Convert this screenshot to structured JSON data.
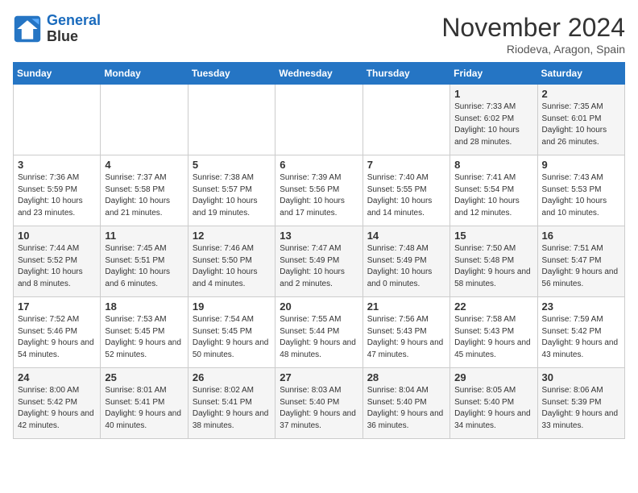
{
  "header": {
    "logo_line1": "General",
    "logo_line2": "Blue",
    "month": "November 2024",
    "location": "Riodeva, Aragon, Spain"
  },
  "weekdays": [
    "Sunday",
    "Monday",
    "Tuesday",
    "Wednesday",
    "Thursday",
    "Friday",
    "Saturday"
  ],
  "weeks": [
    [
      {
        "day": "",
        "info": ""
      },
      {
        "day": "",
        "info": ""
      },
      {
        "day": "",
        "info": ""
      },
      {
        "day": "",
        "info": ""
      },
      {
        "day": "",
        "info": ""
      },
      {
        "day": "1",
        "info": "Sunrise: 7:33 AM\nSunset: 6:02 PM\nDaylight: 10 hours\nand 28 minutes."
      },
      {
        "day": "2",
        "info": "Sunrise: 7:35 AM\nSunset: 6:01 PM\nDaylight: 10 hours\nand 26 minutes."
      }
    ],
    [
      {
        "day": "3",
        "info": "Sunrise: 7:36 AM\nSunset: 5:59 PM\nDaylight: 10 hours\nand 23 minutes."
      },
      {
        "day": "4",
        "info": "Sunrise: 7:37 AM\nSunset: 5:58 PM\nDaylight: 10 hours\nand 21 minutes."
      },
      {
        "day": "5",
        "info": "Sunrise: 7:38 AM\nSunset: 5:57 PM\nDaylight: 10 hours\nand 19 minutes."
      },
      {
        "day": "6",
        "info": "Sunrise: 7:39 AM\nSunset: 5:56 PM\nDaylight: 10 hours\nand 17 minutes."
      },
      {
        "day": "7",
        "info": "Sunrise: 7:40 AM\nSunset: 5:55 PM\nDaylight: 10 hours\nand 14 minutes."
      },
      {
        "day": "8",
        "info": "Sunrise: 7:41 AM\nSunset: 5:54 PM\nDaylight: 10 hours\nand 12 minutes."
      },
      {
        "day": "9",
        "info": "Sunrise: 7:43 AM\nSunset: 5:53 PM\nDaylight: 10 hours\nand 10 minutes."
      }
    ],
    [
      {
        "day": "10",
        "info": "Sunrise: 7:44 AM\nSunset: 5:52 PM\nDaylight: 10 hours\nand 8 minutes."
      },
      {
        "day": "11",
        "info": "Sunrise: 7:45 AM\nSunset: 5:51 PM\nDaylight: 10 hours\nand 6 minutes."
      },
      {
        "day": "12",
        "info": "Sunrise: 7:46 AM\nSunset: 5:50 PM\nDaylight: 10 hours\nand 4 minutes."
      },
      {
        "day": "13",
        "info": "Sunrise: 7:47 AM\nSunset: 5:49 PM\nDaylight: 10 hours\nand 2 minutes."
      },
      {
        "day": "14",
        "info": "Sunrise: 7:48 AM\nSunset: 5:49 PM\nDaylight: 10 hours\nand 0 minutes."
      },
      {
        "day": "15",
        "info": "Sunrise: 7:50 AM\nSunset: 5:48 PM\nDaylight: 9 hours\nand 58 minutes."
      },
      {
        "day": "16",
        "info": "Sunrise: 7:51 AM\nSunset: 5:47 PM\nDaylight: 9 hours\nand 56 minutes."
      }
    ],
    [
      {
        "day": "17",
        "info": "Sunrise: 7:52 AM\nSunset: 5:46 PM\nDaylight: 9 hours\nand 54 minutes."
      },
      {
        "day": "18",
        "info": "Sunrise: 7:53 AM\nSunset: 5:45 PM\nDaylight: 9 hours\nand 52 minutes."
      },
      {
        "day": "19",
        "info": "Sunrise: 7:54 AM\nSunset: 5:45 PM\nDaylight: 9 hours\nand 50 minutes."
      },
      {
        "day": "20",
        "info": "Sunrise: 7:55 AM\nSunset: 5:44 PM\nDaylight: 9 hours\nand 48 minutes."
      },
      {
        "day": "21",
        "info": "Sunrise: 7:56 AM\nSunset: 5:43 PM\nDaylight: 9 hours\nand 47 minutes."
      },
      {
        "day": "22",
        "info": "Sunrise: 7:58 AM\nSunset: 5:43 PM\nDaylight: 9 hours\nand 45 minutes."
      },
      {
        "day": "23",
        "info": "Sunrise: 7:59 AM\nSunset: 5:42 PM\nDaylight: 9 hours\nand 43 minutes."
      }
    ],
    [
      {
        "day": "24",
        "info": "Sunrise: 8:00 AM\nSunset: 5:42 PM\nDaylight: 9 hours\nand 42 minutes."
      },
      {
        "day": "25",
        "info": "Sunrise: 8:01 AM\nSunset: 5:41 PM\nDaylight: 9 hours\nand 40 minutes."
      },
      {
        "day": "26",
        "info": "Sunrise: 8:02 AM\nSunset: 5:41 PM\nDaylight: 9 hours\nand 38 minutes."
      },
      {
        "day": "27",
        "info": "Sunrise: 8:03 AM\nSunset: 5:40 PM\nDaylight: 9 hours\nand 37 minutes."
      },
      {
        "day": "28",
        "info": "Sunrise: 8:04 AM\nSunset: 5:40 PM\nDaylight: 9 hours\nand 36 minutes."
      },
      {
        "day": "29",
        "info": "Sunrise: 8:05 AM\nSunset: 5:40 PM\nDaylight: 9 hours\nand 34 minutes."
      },
      {
        "day": "30",
        "info": "Sunrise: 8:06 AM\nSunset: 5:39 PM\nDaylight: 9 hours\nand 33 minutes."
      }
    ]
  ]
}
